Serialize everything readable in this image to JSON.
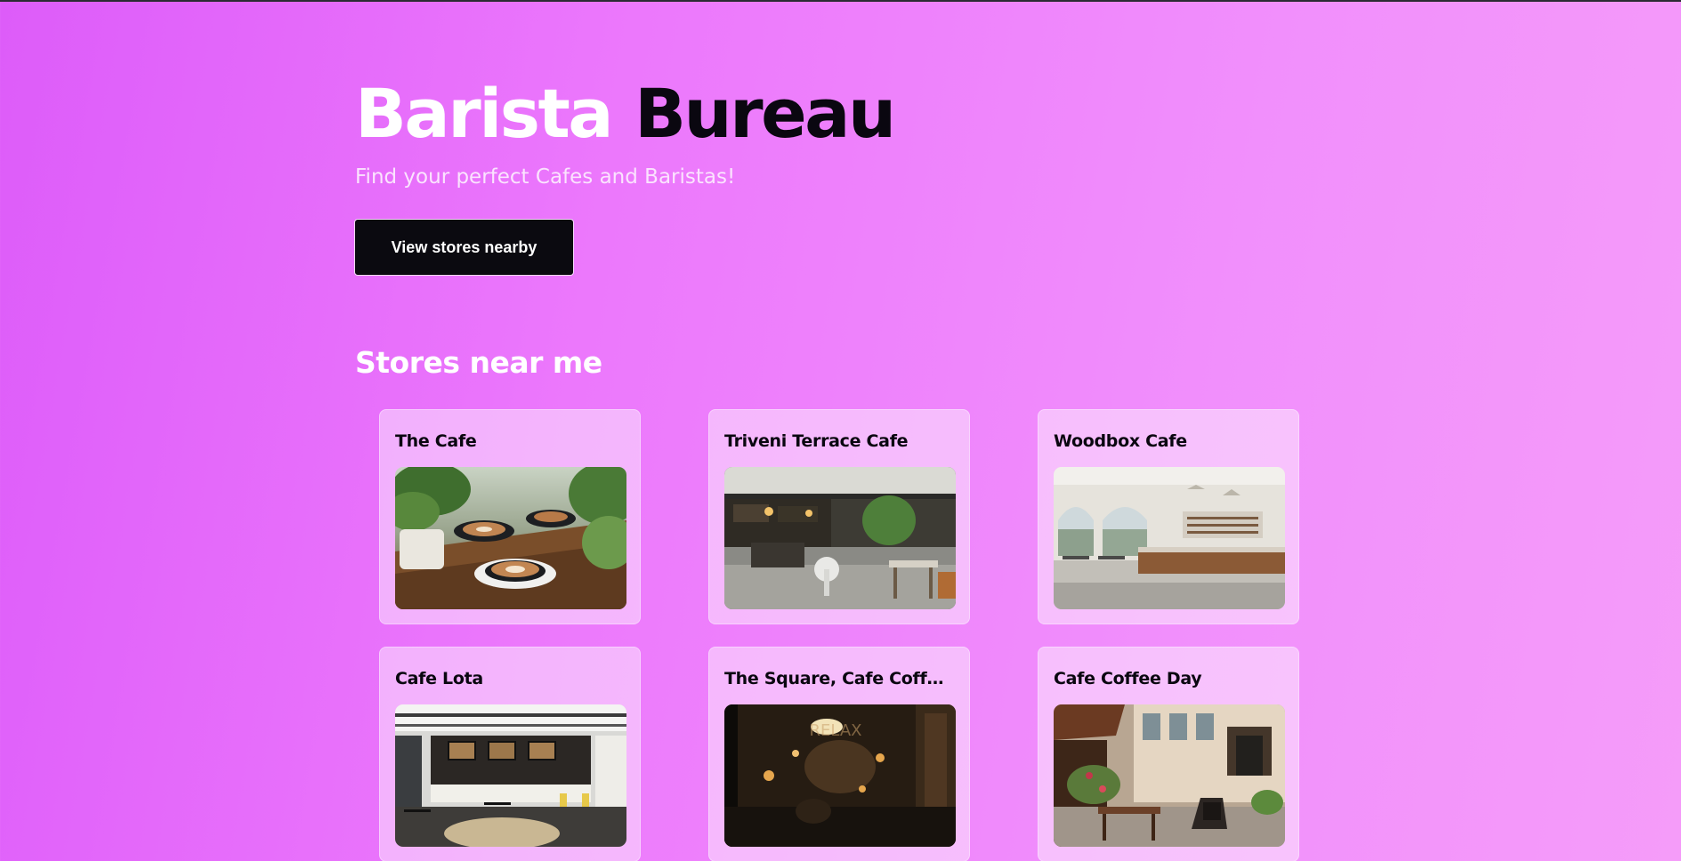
{
  "hero": {
    "title_word1": "Barista",
    "title_word2": "Bureau",
    "subtitle": "Find your perfect Cafes and Baristas!",
    "cta_label": "View stores nearby"
  },
  "section": {
    "title": "Stores near me"
  },
  "stores": [
    {
      "name": "The Cafe",
      "image": "latte-art-cups-photo"
    },
    {
      "name": "Triveni Terrace Cafe",
      "image": "cafe-interior-seating-photo"
    },
    {
      "name": "Woodbox Cafe",
      "image": "bright-cafe-counter-photo"
    },
    {
      "name": "Cafe Lota",
      "image": "modern-cafe-interior-photo"
    },
    {
      "name": "The Square, Cafe Coffe...",
      "image": "night-cafe-window-relax-photo"
    },
    {
      "name": "Cafe Coffee Day",
      "image": "street-cafe-terrace-photo"
    }
  ]
}
